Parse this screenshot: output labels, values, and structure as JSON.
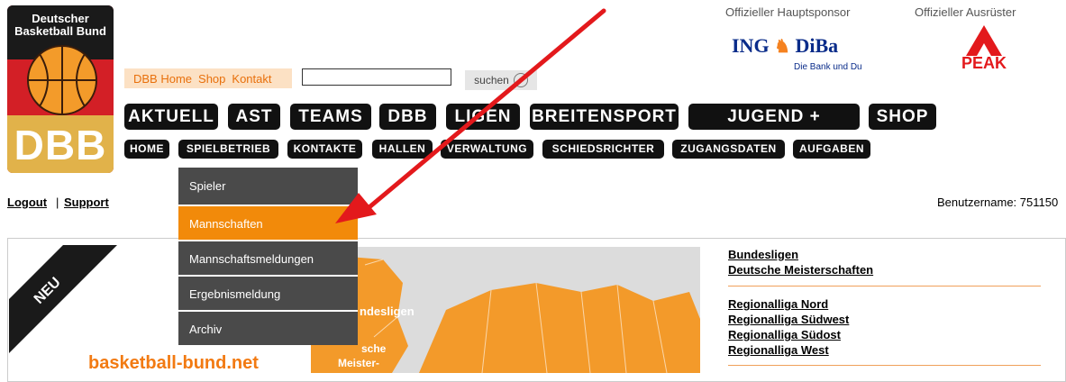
{
  "logo": {
    "line1": "Deutscher",
    "line2": "Basketball Bund",
    "abbr": "DBB"
  },
  "sponsor": {
    "main_label": "Offizieller Hauptsponsor",
    "main_name": "ING",
    "main_name2": "DiBa",
    "main_tagline": "Die Bank und Du",
    "outfitter_label": "Offizieller Ausrüster",
    "outfitter_name": "PEAK"
  },
  "quicklinks": [
    "DBB Home",
    "Shop",
    "Kontakt"
  ],
  "search": {
    "value": "",
    "button_label": "suchen"
  },
  "nav_main": [
    "AKTUELL",
    "AST",
    "TEAMS",
    "DBB",
    "LIGEN",
    "BREITENSPORT",
    "JUGEND + SCHULE",
    "SHOP"
  ],
  "nav_sub": [
    "HOME",
    "SPIELBETRIEB",
    "KONTAKTE",
    "HALLEN",
    "VERWALTUNG",
    "SCHIEDSRICHTER",
    "ZUGANGSDATEN",
    "AUFGABEN"
  ],
  "dropdown": [
    "Spieler",
    "Mannschaften",
    "Mannschaftsmeldungen",
    "Ergebnismeldung",
    "Archiv"
  ],
  "dropdown_active": "Mannschaften",
  "session": {
    "logout": "Logout",
    "separator": "|",
    "support": "Support",
    "username": "Benutzername: 751150"
  },
  "content": {
    "badge": "NEU",
    "brand": "basketball-bund.net",
    "map_labels": [
      "ndesligen",
      "sche",
      "Meister-"
    ],
    "links_group1": [
      "Bundesligen",
      "Deutsche Meisterschaften"
    ],
    "links_group2": [
      "Regionalliga Nord",
      "Regionalliga Südwest",
      "Regionalliga Südost",
      "Regionalliga West"
    ]
  },
  "colors": {
    "accent_orange": "#f28a0a",
    "nav_black": "#111111",
    "dropdown_gray": "#4a4a4a",
    "arrow_red": "#e3191c"
  }
}
